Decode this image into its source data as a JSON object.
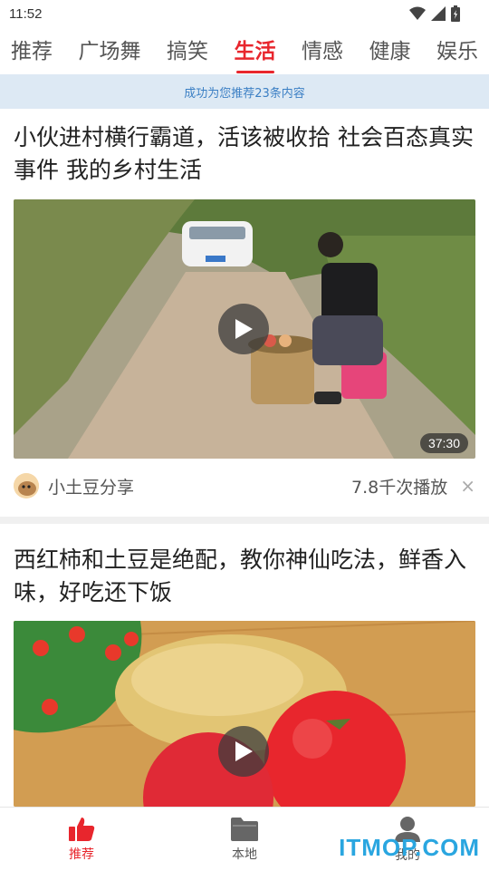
{
  "status_bar": {
    "time": "11:52"
  },
  "tabs": [
    {
      "label": "推荐",
      "active": false
    },
    {
      "label": "广场舞",
      "active": false
    },
    {
      "label": "搞笑",
      "active": false
    },
    {
      "label": "生活",
      "active": true
    },
    {
      "label": "情感",
      "active": false
    },
    {
      "label": "健康",
      "active": false
    },
    {
      "label": "娱乐",
      "active": false
    }
  ],
  "notice": "成功为您推荐23条内容",
  "feed": [
    {
      "title": "小伙进村横行霸道，活该被收拾 社会百态真实事件 我的乡村生活",
      "duration": "37:30",
      "author": "小土豆分享",
      "plays": "7.8千次播放",
      "close": "×"
    },
    {
      "title": "西红柿和土豆是绝配，教你神仙吃法，鲜香入味，好吃还下饭"
    }
  ],
  "bottom_nav": [
    {
      "label": "推荐",
      "icon": "thumbs-up-icon",
      "active": true
    },
    {
      "label": "本地",
      "icon": "folder-icon",
      "active": false
    },
    {
      "label": "我的",
      "icon": "person-icon",
      "active": false
    }
  ],
  "watermark": "ITMOP.COM",
  "colors": {
    "accent": "#e8262d",
    "notice_bg": "#dde9f4",
    "notice_text": "#3b7fc4",
    "watermark": "#2aa6e0"
  }
}
